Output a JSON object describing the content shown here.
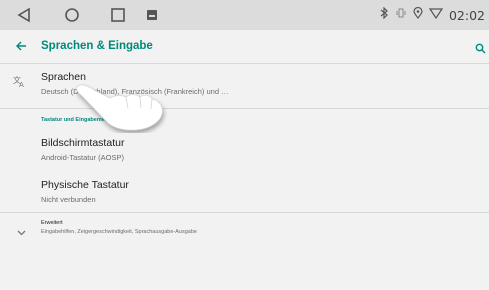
{
  "status": {
    "time": "02:02"
  },
  "appbar": {
    "title": "Sprachen & Eingabe"
  },
  "items": {
    "sprachen": {
      "title": "Sprachen",
      "summary": "Deutsch (Deutschland), Französisch (Frankreich) und …"
    },
    "category": "Tastatur und Eingabemethoden",
    "bildschirm": {
      "title": "Bildschirmtastatur",
      "summary": "Android-Tastatur (AOSP)"
    },
    "physisch": {
      "title": "Physische Tastatur",
      "summary": "Nicht verbunden"
    },
    "erweitert": {
      "title": "Erweitert",
      "summary": "Eingabehilfen, Zeigergeschwindigkeit, Sprachausgabe-Ausgabe"
    }
  },
  "colors": {
    "accent": "#00897b",
    "statusbar": "#dcdcdc",
    "background": "#f2f2f2"
  }
}
